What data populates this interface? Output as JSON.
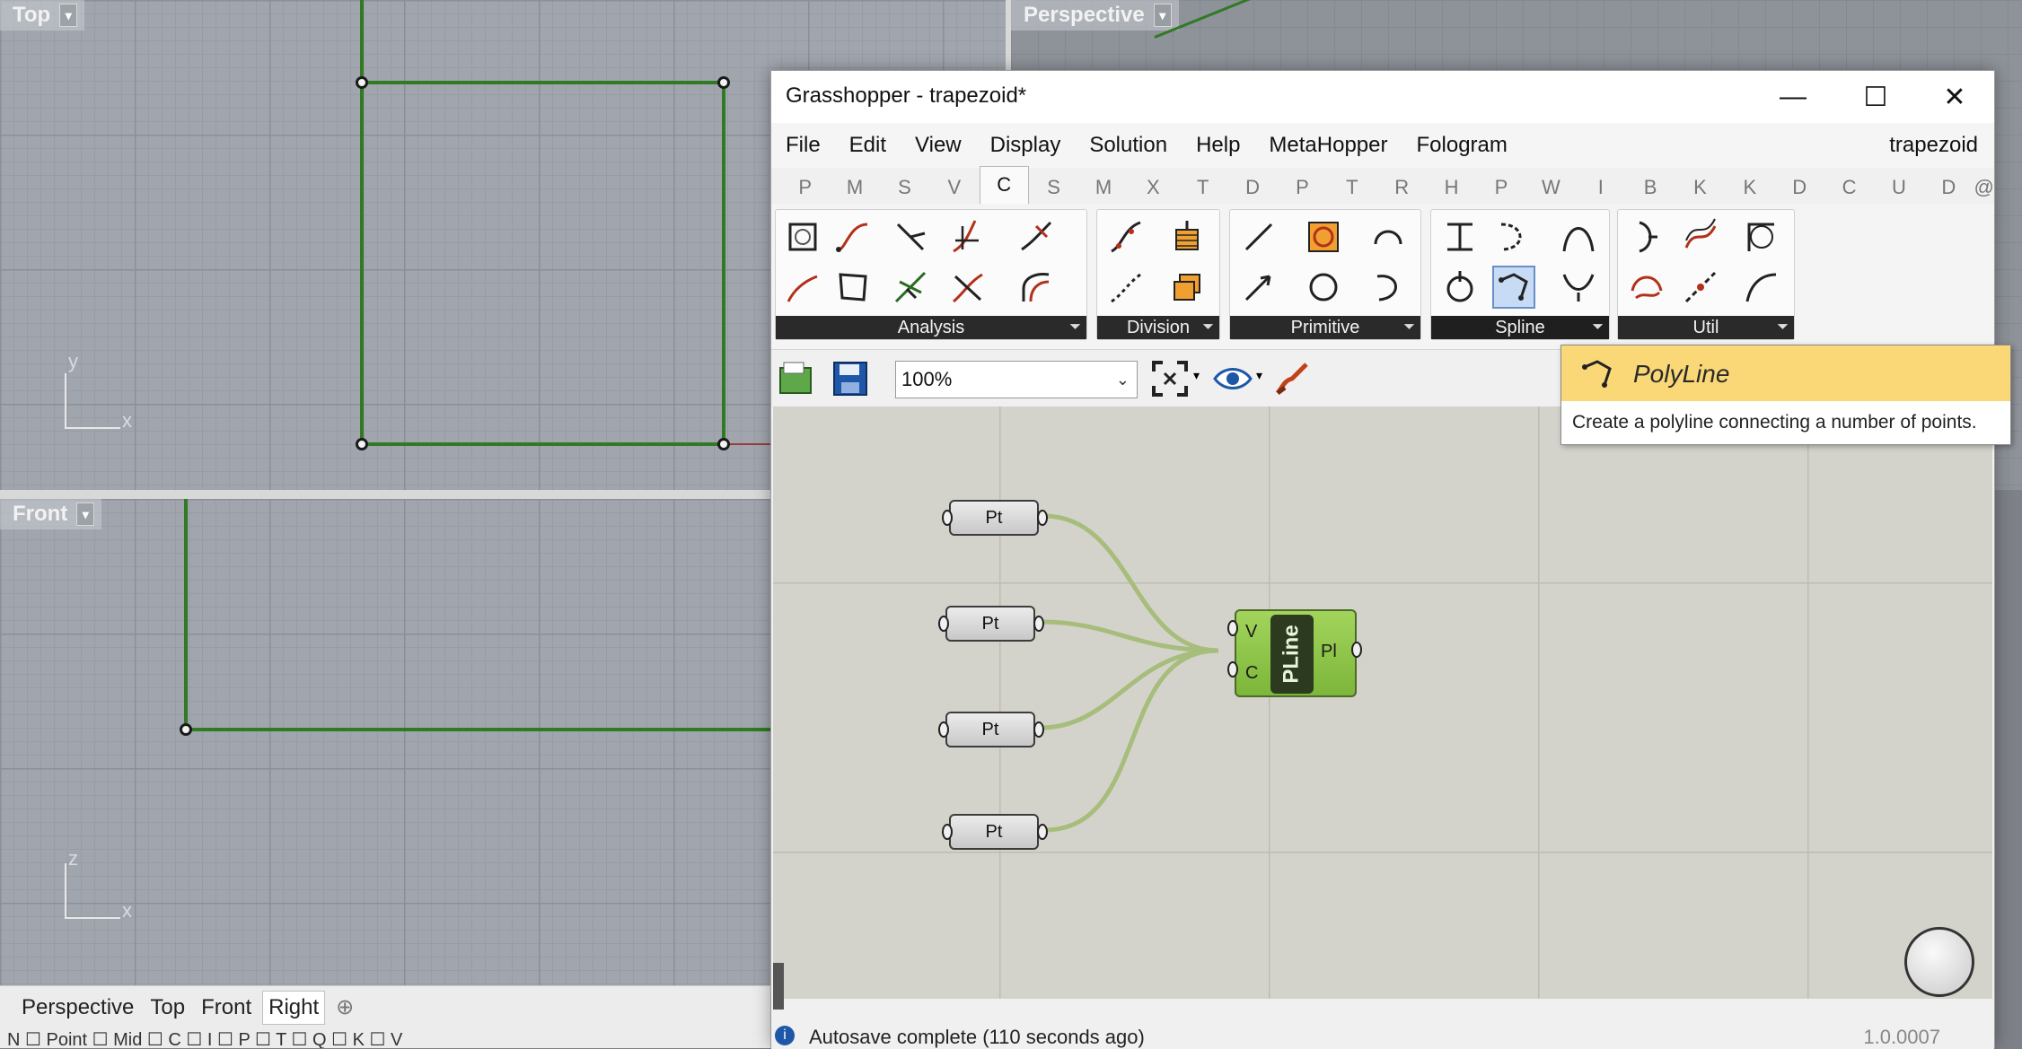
{
  "viewports": {
    "top_label": "Top",
    "front_label": "Front",
    "perspective_label": "Perspective",
    "axis_y": "y",
    "axis_x": "x",
    "axis_z": "z",
    "bottom_tabs": [
      "Perspective",
      "Top",
      "Front",
      "Right"
    ],
    "add_tab_icon": "⊕",
    "osnap_text": "N    ☐ Point  ☐ Mid  ☐ C    ☐ I     ☐ P     ☐ T     ☐ Q    ☐ K    ☐ V"
  },
  "grasshopper": {
    "title": "Grasshopper - trapezoid*",
    "menu": [
      "File",
      "Edit",
      "View",
      "Display",
      "Solution",
      "Help",
      "MetaHopper",
      "Fologram"
    ],
    "document_name": "trapezoid",
    "tabs": [
      "P",
      "M",
      "S",
      "V",
      "C",
      "S",
      "M",
      "X",
      "T",
      "D",
      "P",
      "T",
      "R",
      "H",
      "P",
      "W",
      "I",
      "B",
      "K",
      "K",
      "D",
      "C",
      "U",
      "D",
      "@"
    ],
    "active_tab": "C",
    "groups": [
      "Analysis",
      "Division",
      "Primitive",
      "Spline",
      "Util"
    ],
    "group_expand": "⏷",
    "zoom": "100%",
    "canvas": {
      "params": [
        "Pt",
        "Pt",
        "Pt",
        "Pt"
      ],
      "component": {
        "name": "PLine",
        "inputs": [
          "V",
          "C"
        ],
        "output": "Pl"
      }
    },
    "status": {
      "message": "Autosave complete (110 seconds ago)",
      "version": "1.0.0007"
    },
    "tooltip": {
      "title": "PolyLine",
      "description": "Create a polyline connecting a number of points."
    }
  },
  "colors": {
    "geometry_green": "#2f7a22",
    "component_green": "#8bc34a",
    "tooltip_yellow": "#fad777",
    "wire_green": "#9bb868"
  }
}
